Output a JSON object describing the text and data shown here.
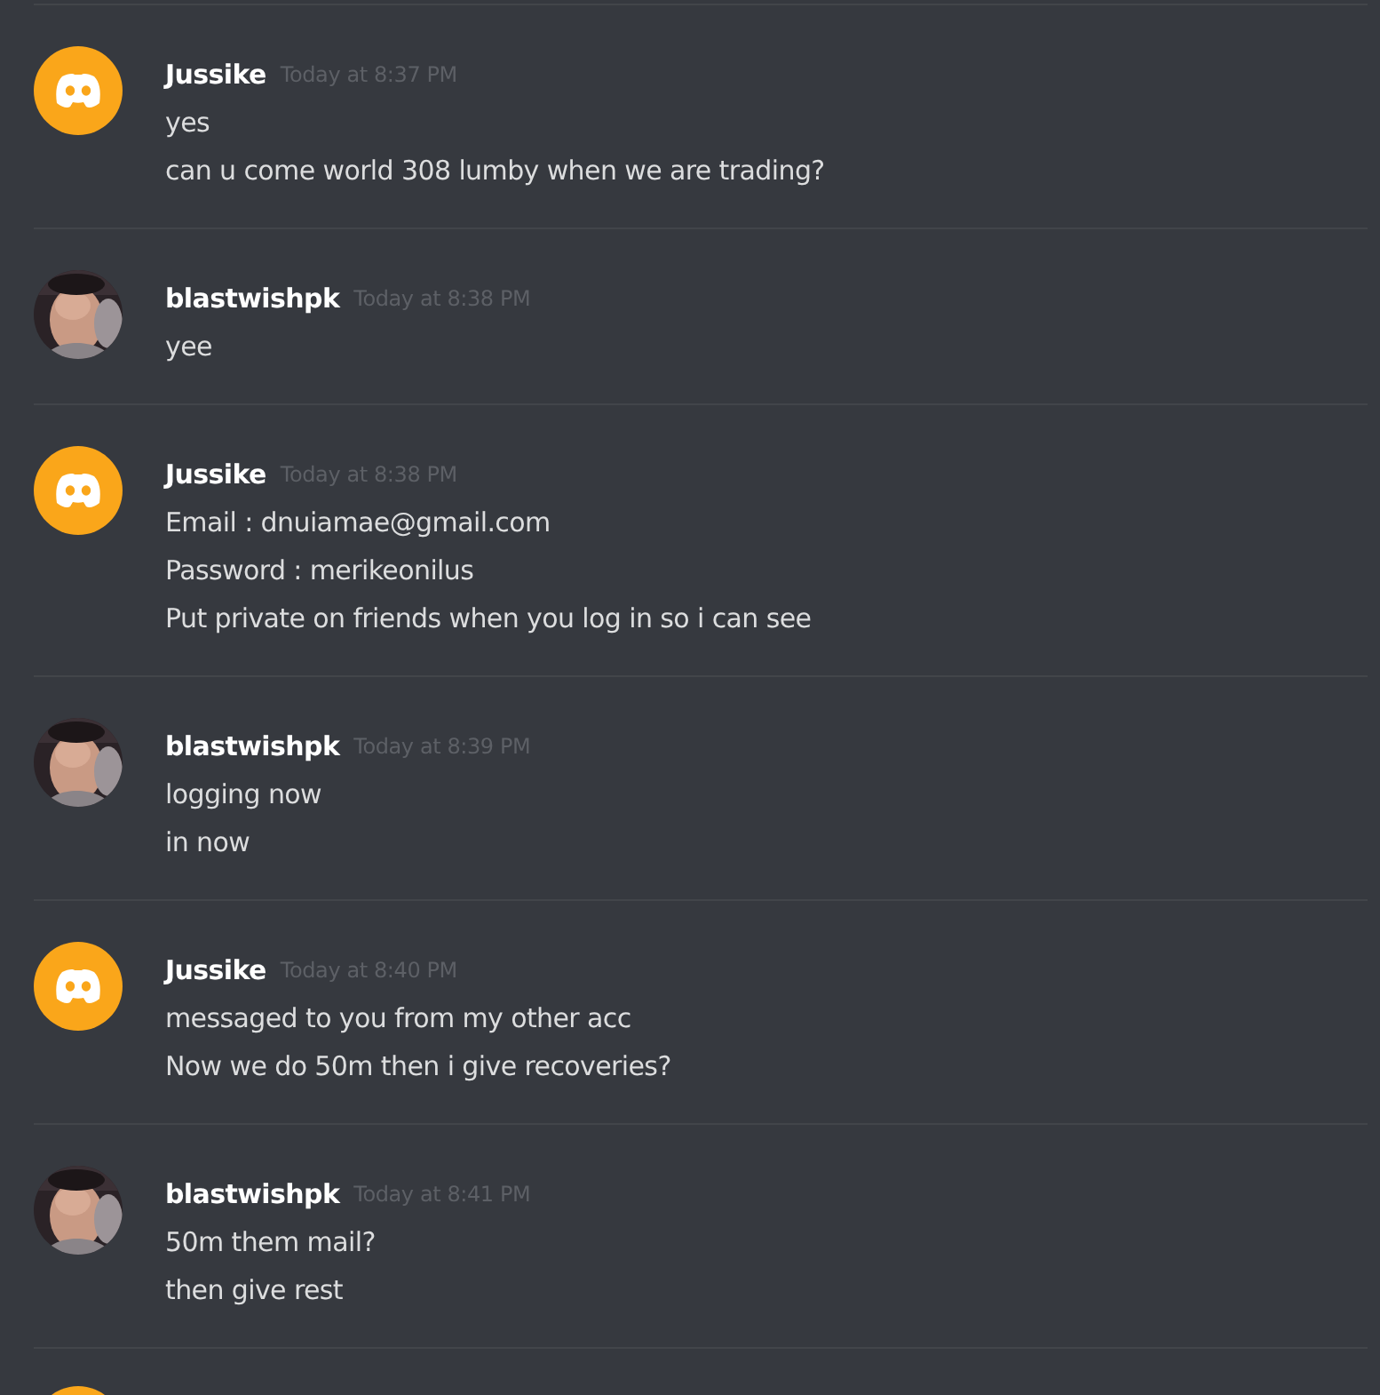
{
  "messages": [
    {
      "kind": "discord",
      "author": "Jussike",
      "timestamp": "Today at 8:37 PM",
      "lines": [
        "yes",
        "can u come world 308 lumby when we are trading?"
      ]
    },
    {
      "author": "blastwishpk",
      "timestamp": "Today at 8:38 PM",
      "lines": [
        "yee"
      ]
    },
    {
      "kind": "discord",
      "author": "Jussike",
      "timestamp": "Today at 8:38 PM",
      "lines": [
        "Email : dnuiamae@gmail.com",
        "Password : merikeonilus",
        "Put private on friends when you log in so i can see"
      ]
    },
    {
      "author": "blastwishpk",
      "timestamp": "Today at 8:39 PM",
      "lines": [
        "logging now",
        "in now"
      ]
    },
    {
      "kind": "discord",
      "author": "Jussike",
      "timestamp": "Today at 8:40 PM",
      "lines": [
        "messaged to you from my other acc",
        "Now we do 50m then i give recoveries?"
      ]
    },
    {
      "author": "blastwishpk",
      "timestamp": "Today at 8:41 PM",
      "lines": [
        "50m them mail?",
        "then give rest"
      ]
    },
    {
      "kind": "discord"
    }
  ]
}
